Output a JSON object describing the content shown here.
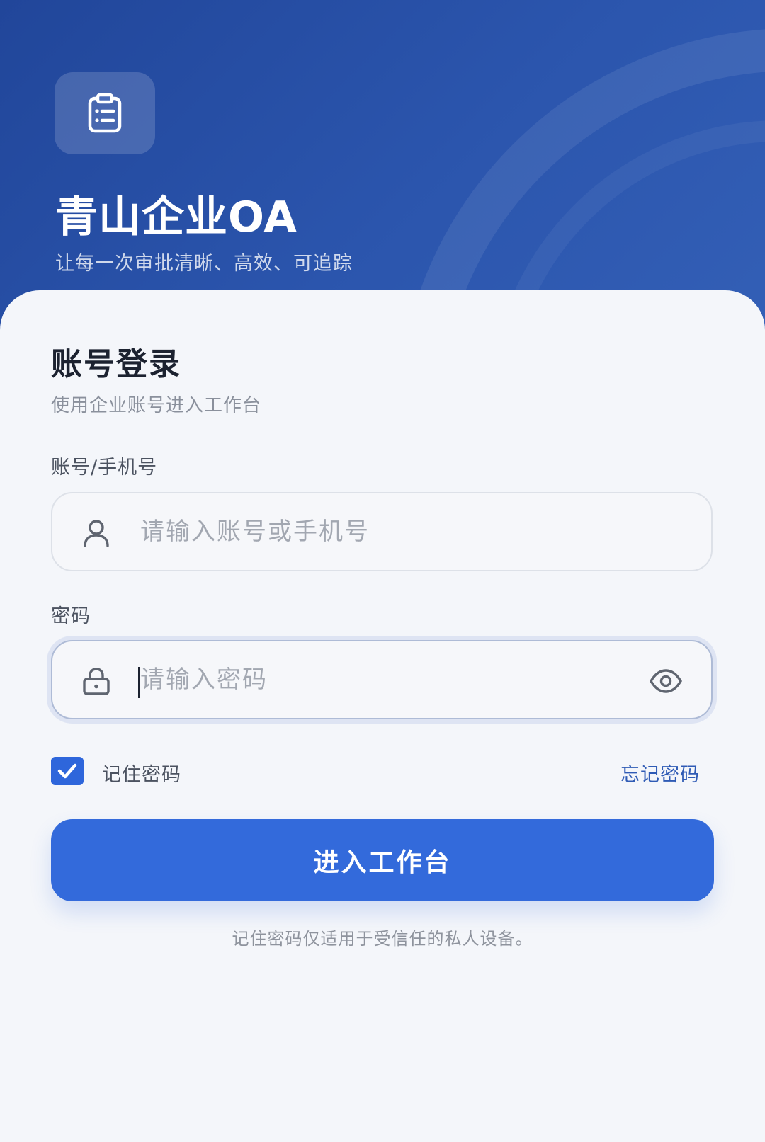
{
  "colors": {
    "header_bg": "#2a52a8",
    "primary": "#336adb",
    "link": "#2f5bb5",
    "page_bg": "#f4f6fa"
  },
  "header": {
    "logo_icon": "clipboard-list-icon",
    "title": "青山企业OA",
    "slogan": "让每一次审批清晰、高效、可追踪"
  },
  "login": {
    "title": "账号登录",
    "subtitle": "使用企业账号进入工作台",
    "account": {
      "label": "账号/手机号",
      "placeholder": "请输入账号或手机号",
      "value": "",
      "icon": "user-icon"
    },
    "password": {
      "label": "密码",
      "placeholder": "请输入密码",
      "value": "",
      "icon": "lock-icon",
      "toggle_icon": "eye-icon",
      "focused": true
    },
    "remember": {
      "label": "记住密码",
      "checked": true
    },
    "forgot_label": "忘记密码",
    "submit_label": "进入工作台",
    "hint": "记住密码仅适用于受信任的私人设备。"
  }
}
